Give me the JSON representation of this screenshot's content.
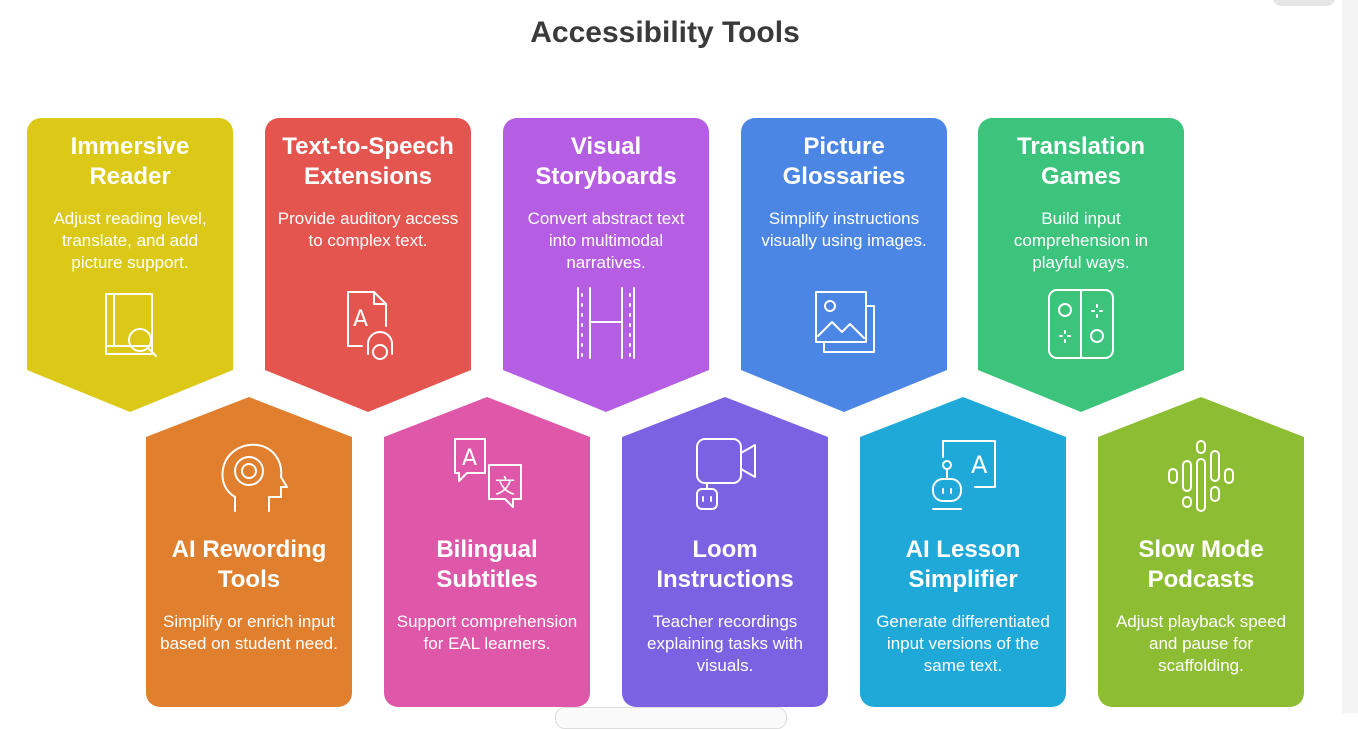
{
  "title": "Accessibility Tools",
  "top_cards": [
    {
      "title": "Immersive Reader",
      "desc": "Adjust reading level, translate, and add picture support.",
      "icon": "book-search-icon",
      "color": "#dcc816"
    },
    {
      "title": "Text-to-Speech Extensions",
      "desc": "Provide auditory access to complex text.",
      "icon": "document-headphones-icon",
      "color": "#e5554f"
    },
    {
      "title": "Visual Storyboards",
      "desc": "Convert abstract text into multimodal narratives.",
      "icon": "film-strip-icon",
      "color": "#b55de3"
    },
    {
      "title": "Picture Glossaries",
      "desc": "Simplify instructions visually using images.",
      "icon": "picture-stack-icon",
      "color": "#4b86e4"
    },
    {
      "title": "Translation Games",
      "desc": "Build input comprehension in playful ways.",
      "icon": "game-controller-icon",
      "color": "#3cc47c"
    }
  ],
  "bottom_cards": [
    {
      "title": "AI Rewording Tools",
      "desc": "Simplify or enrich input based on student need.",
      "icon": "head-gear-icon",
      "color": "#e07f2e"
    },
    {
      "title": "Bilingual Subtitles",
      "desc": "Support comprehension for EAL learners.",
      "icon": "translate-bubbles-icon",
      "color": "#de57a8"
    },
    {
      "title": "Loom Instructions",
      "desc": "Teacher recordings explaining tasks with visuals.",
      "icon": "video-camera-robot-icon",
      "color": "#7a62e3"
    },
    {
      "title": "AI Lesson Simplifier",
      "desc": "Generate differentiated input versions of the same text.",
      "icon": "robot-whiteboard-icon",
      "color": "#1fa9d8"
    },
    {
      "title": "Slow Mode Podcasts",
      "desc": "Adjust playback speed and pause for scaffolding.",
      "icon": "audio-waveform-icon",
      "color": "#8dbd33"
    }
  ],
  "icon_glyphs": {
    "letter_a": "A",
    "wen": "文"
  }
}
